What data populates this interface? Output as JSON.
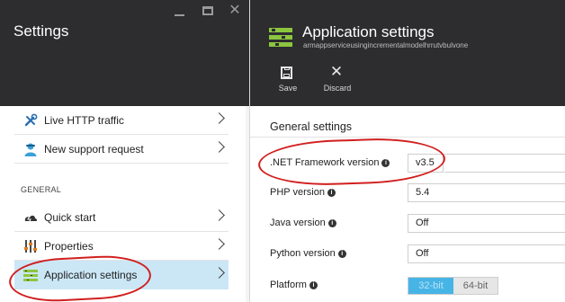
{
  "left_blade": {
    "title": "Settings",
    "window_controls": [
      "minimize-icon",
      "maximize-icon",
      "close-icon"
    ],
    "items": [
      {
        "label": "Live HTTP traffic",
        "icon": "tools-icon"
      },
      {
        "label": "New support request",
        "icon": "support-person-icon"
      }
    ],
    "section_general": "GENERAL",
    "general_items": [
      {
        "label": "Quick start",
        "icon": "cloud-lightning-icon"
      },
      {
        "label": "Properties",
        "icon": "properties-sliders-icon"
      },
      {
        "label": "Application settings",
        "icon": "app-settings-icon"
      }
    ],
    "selected_item": "Application settings"
  },
  "right_blade": {
    "title": "Application settings",
    "subtitle": "armappserviceusingincrementalmodelhrrutvbulvone",
    "commands": {
      "save_label": "Save",
      "discard_label": "Discard"
    },
    "general_heading": "General settings",
    "settings": {
      "net": {
        "label": ".NET Framework version",
        "value": "v3.5"
      },
      "php": {
        "label": "PHP version",
        "value": "5.4"
      },
      "java": {
        "label": "Java version",
        "value": "Off"
      },
      "python": {
        "label": "Python version",
        "value": "Off"
      },
      "platform": {
        "label": "Platform",
        "option_32": "32-bit",
        "option_64": "64-bit",
        "selected": "32-bit"
      }
    }
  },
  "colors": {
    "header_bg": "#2d2d30",
    "selected_item_bg": "#cbe7f6",
    "icon_green": "#8cc63f",
    "toggle_selected": "#47b4e6",
    "annotation_red": "#d11f1f"
  }
}
